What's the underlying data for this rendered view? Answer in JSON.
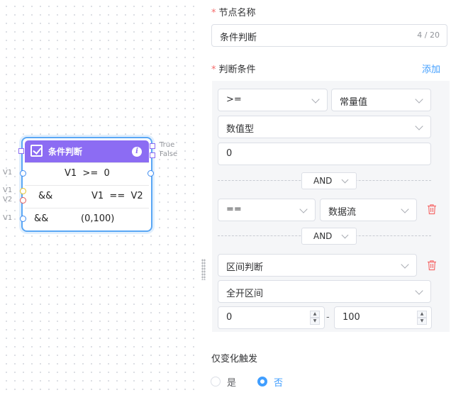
{
  "canvas": {
    "node": {
      "title": "条件判断",
      "outputs": [
        "True",
        "False"
      ],
      "rows": [
        {
          "port_labels": [
            "V1"
          ],
          "left": "",
          "expr": "V1  >=  0"
        },
        {
          "port_labels": [
            "V1",
            "V2"
          ],
          "left": "&&",
          "expr": "V1  ==  V2"
        },
        {
          "port_labels": [
            "V1"
          ],
          "left": "&&",
          "expr": "(0,100)"
        }
      ]
    }
  },
  "panel": {
    "node_name": {
      "label": "节点名称",
      "value": "条件判断",
      "count": "4 / 20"
    },
    "conditions": {
      "label": "判断条件",
      "add_label": "添加",
      "c1": {
        "operator": ">=",
        "source": "常量值",
        "data_type": "数值型",
        "value": "0"
      },
      "and1": "AND",
      "c2": {
        "operator": "==",
        "source": "数据流"
      },
      "and2": "AND",
      "c3": {
        "operator": "区间判断",
        "interval": "全开区间",
        "min": "0",
        "range_sep": "-",
        "max": "100"
      }
    },
    "trigger": {
      "label": "仅变化触发",
      "options": [
        {
          "label": "是",
          "selected": false
        },
        {
          "label": "否",
          "selected": true
        }
      ]
    }
  },
  "colors": {
    "accent": "#409eff",
    "node_header": "#8c6cf3",
    "required": "#f56c6c",
    "delete": "#f56c6c"
  },
  "icons": [
    "checkbox-icon",
    "info-icon",
    "chevron-down-icon",
    "trash-icon",
    "spinner-arrows-icon"
  ]
}
